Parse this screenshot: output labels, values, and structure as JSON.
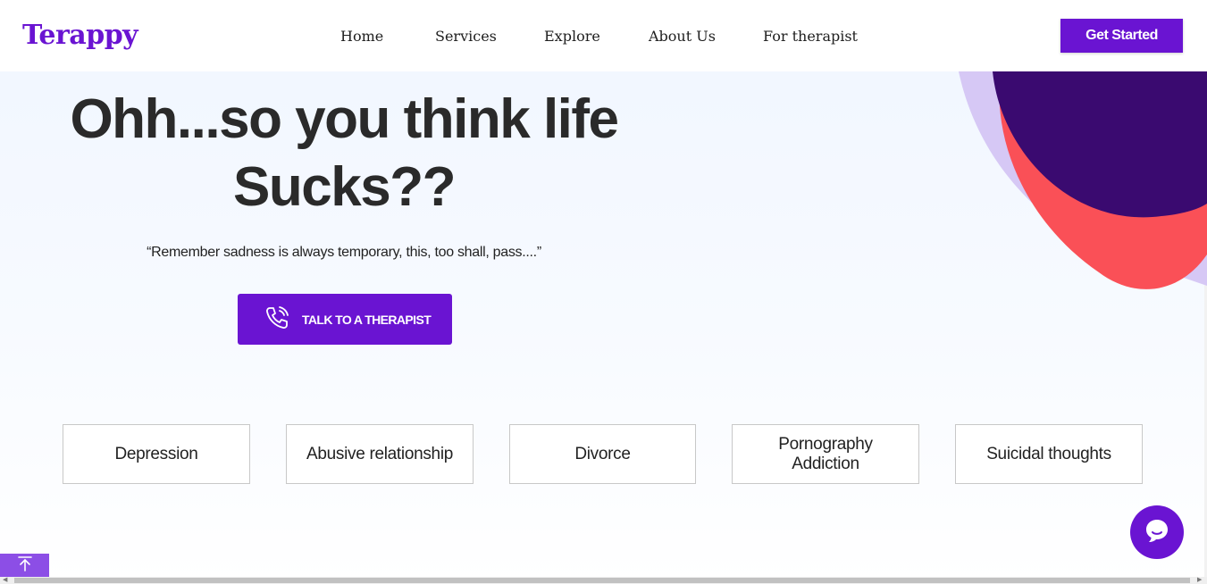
{
  "header": {
    "logo": "Terappy",
    "nav": [
      "Home",
      "Services",
      "Explore",
      "About Us",
      "For therapist"
    ],
    "cta": "Get Started"
  },
  "hero": {
    "title_line1": "Ohh...so you think life",
    "title_line2": "Sucks??",
    "quote": "“Remember sadness is always temporary, this, too shall, pass....”",
    "button_label": "TALK TO A THERAPIST",
    "button_icon": "phone-ringing-icon"
  },
  "topics": [
    "Depression",
    "Abusive relationship",
    "Divorce",
    "Pornography Addiction",
    "Suicidal thoughts"
  ],
  "widgets": {
    "chat_icon": "chat-bubble-icon",
    "scroll_top_icon": "arrow-up-to-top-icon"
  },
  "colors": {
    "brand": "#6a14d2",
    "blob_dark": "#3a0a70",
    "blob_red": "#fa5057",
    "blob_lavender": "#d6c8f5"
  }
}
